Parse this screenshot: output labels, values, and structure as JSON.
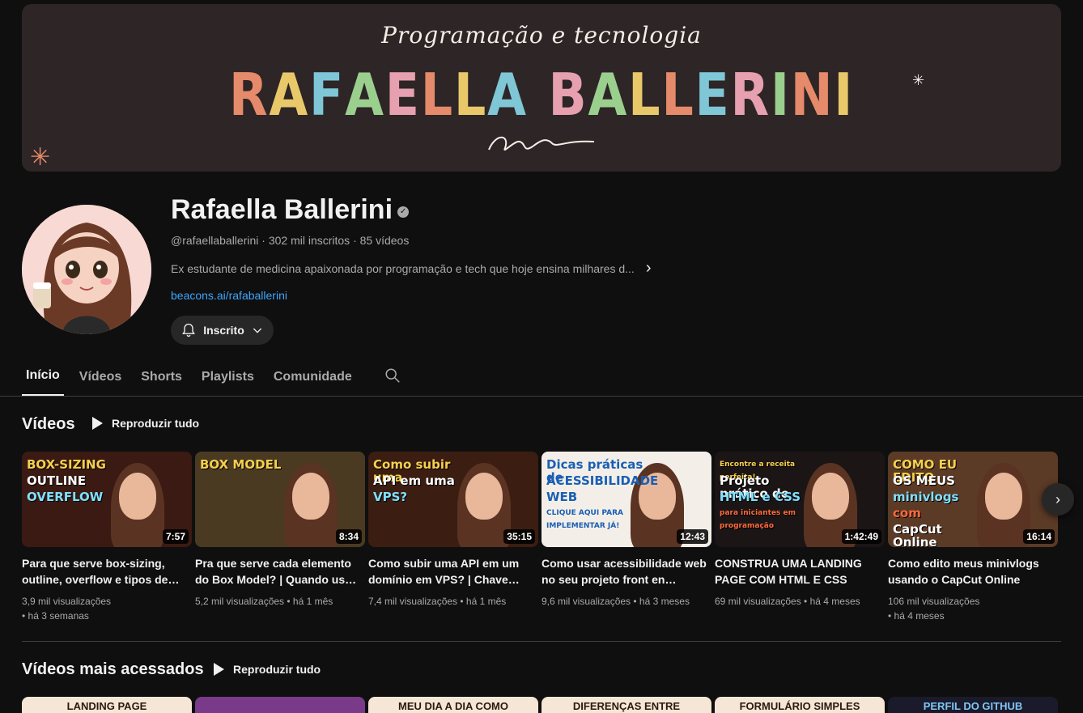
{
  "banner": {
    "subtitle": "Programação e tecnologia",
    "name_letters": [
      {
        "ch": "R",
        "color": "#e58a6a"
      },
      {
        "ch": "A",
        "color": "#e9c86a"
      },
      {
        "ch": "F",
        "color": "#7fc6d6"
      },
      {
        "ch": "A",
        "color": "#9bcf8e"
      },
      {
        "ch": "E",
        "color": "#e6a0b0"
      },
      {
        "ch": "L",
        "color": "#e58a6a"
      },
      {
        "ch": "L",
        "color": "#e9c86a"
      },
      {
        "ch": "A",
        "color": "#7fc6d6"
      },
      {
        "ch": " ",
        "color": "#ffffff"
      },
      {
        "ch": "B",
        "color": "#e6a0b0"
      },
      {
        "ch": "A",
        "color": "#9bcf8e"
      },
      {
        "ch": "L",
        "color": "#e9c86a"
      },
      {
        "ch": "L",
        "color": "#e58a6a"
      },
      {
        "ch": "E",
        "color": "#7fc6d6"
      },
      {
        "ch": "R",
        "color": "#e6a0b0"
      },
      {
        "ch": "I",
        "color": "#9bcf8e"
      },
      {
        "ch": "N",
        "color": "#e58a6a"
      },
      {
        "ch": "I",
        "color": "#e9c86a"
      }
    ]
  },
  "channel": {
    "name": "Rafaella Ballerini",
    "meta": "@rafaellaballerini · 302 mil inscritos · 85 vídeos",
    "description": "Ex estudante de medicina apaixonada por programação e tech que hoje ensina milhares d...",
    "link": "beacons.ai/rafaballerini",
    "subscribe_label": "Inscrito"
  },
  "tabs": [
    "Início",
    "Vídeos",
    "Shorts",
    "Playlists",
    "Comunidade"
  ],
  "sections": {
    "videos_title": "Vídeos",
    "play_all": "Reproduzir tudo",
    "popular_title": "Vídeos mais acessados",
    "play_all_2": "Reproduzir tudo"
  },
  "videos": [
    {
      "title": "Para que serve box-sizing, outline, overflow e tipos de…",
      "views": "3,9 mil visualizações",
      "age": "há 3 semanas",
      "wrap": true,
      "duration": "7:57",
      "bg": "#3a1a12",
      "thumb_lines": [
        "BOX-SIZING",
        "OUTLINE",
        "OVERFLOW"
      ]
    },
    {
      "title": "Pra que serve cada elemento do Box Model? | Quando us…",
      "views": "5,2 mil visualizações",
      "age": "há 1 mês",
      "wrap": false,
      "duration": "8:34",
      "bg": "#4a3a22",
      "thumb_lines": [
        "BOX MODEL"
      ]
    },
    {
      "title": "Como subir uma API em um domínio em VPS? | Chave…",
      "views": "7,4 mil visualizações",
      "age": "há 1 mês",
      "wrap": false,
      "duration": "35:15",
      "bg": "#3b1d12",
      "thumb_lines": [
        "Como subir uma",
        "API em uma",
        "VPS?"
      ]
    },
    {
      "title": "Como usar acessibilidade web no seu projeto front en…",
      "views": "9,6 mil visualizações",
      "age": "há 3 meses",
      "wrap": false,
      "duration": "12:43",
      "bg": "#f3efe8",
      "thumb_lines": [
        "Dicas práticas de",
        "ACESSIBILIDADE",
        "WEB",
        "CLIQUE AQUI PARA IMPLEMENTAR JÁ!"
      ]
    },
    {
      "title": "CONSTRUA UMA LANDING PAGE COM HTML E CSS",
      "views": "69 mil visualizações",
      "age": "há 4 meses",
      "wrap": false,
      "duration": "1:42:49",
      "bg": "#1c1515",
      "thumb_lines": [
        "Encontre a receita perfeita!",
        "Projeto prático de",
        "HTML e CSS",
        "para iniciantes em programação"
      ]
    },
    {
      "title": "Como edito meus minivlogs usando o CapCut Online",
      "views": "106 mil visualizações",
      "age": "há 4 meses",
      "wrap": true,
      "duration": "16:14",
      "bg": "#5b3a26",
      "thumb_lines": [
        "COMO EU EDITO",
        "OS MEUS",
        "minivlogs",
        "com",
        "CapCut Online"
      ]
    }
  ],
  "popular": [
    {
      "label": "LANDING PAGE",
      "bg": "#f6e6d6",
      "fg": "#2a1a10"
    },
    {
      "label": "",
      "bg": "#7a3a8a",
      "fg": "#ffffff"
    },
    {
      "label": "MEU DIA A DIA COMO",
      "bg": "#f6e6d6",
      "fg": "#2a1a10"
    },
    {
      "label": "DIFERENÇAS ENTRE",
      "bg": "#f6e6d6",
      "fg": "#2a1a10"
    },
    {
      "label": "FORMULÁRIO SIMPLES",
      "bg": "#f6e6d6",
      "fg": "#2a1a10"
    },
    {
      "label": "PERFIL DO GITHUB",
      "bg": "#1a1a2a",
      "fg": "#7fc6f6"
    }
  ]
}
